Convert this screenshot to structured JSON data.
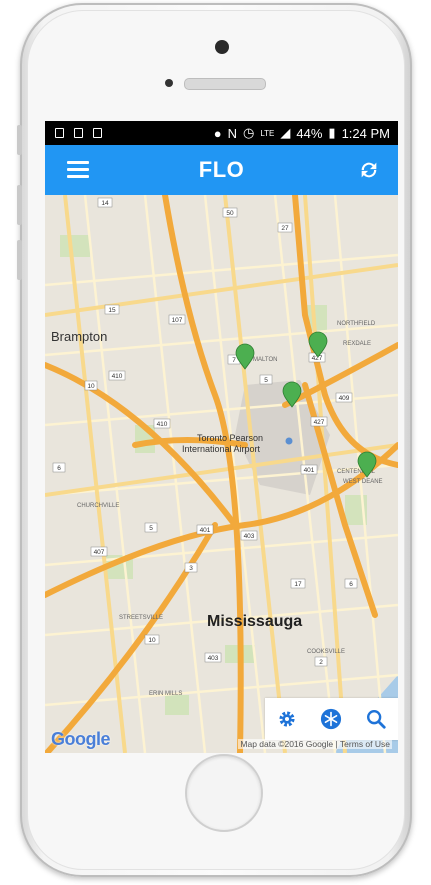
{
  "statusbar": {
    "battery": "44%",
    "time": "1:24 PM",
    "network": "LTE"
  },
  "appbar": {
    "title": "FLO",
    "menu_icon": "menu-icon",
    "refresh_icon": "refresh-icon"
  },
  "map": {
    "places": {
      "brampton": "Brampton",
      "mississauga": "Mississauga",
      "airport_line1": "Toronto Pearson",
      "airport_line2": "International Airport",
      "malton": "MALTON",
      "northfield": "NORTHFIELD",
      "rexdale": "REXDALE",
      "centennial": "CENTENNIAL",
      "west_deane": "WEST DEANE",
      "churchville": "CHURCHVILLE",
      "streetsville": "STREETSVILLE",
      "erin_mills": "ERIN MILLS",
      "cooksville": "COOKSVILLE"
    },
    "shields": [
      "14",
      "50",
      "27",
      "15",
      "107",
      "7",
      "410",
      "10",
      "427",
      "409",
      "5",
      "410",
      "427",
      "401",
      "6",
      "403",
      "401",
      "407",
      "5",
      "3",
      "17",
      "10",
      "403",
      "2",
      "6"
    ],
    "markers_count": 4,
    "logo": "Google",
    "attribution": "Map data ©2016 Google | Terms of Use"
  },
  "controls": {
    "settings_icon": "gear-icon",
    "filter_icon": "snowflake-icon",
    "search_icon": "search-icon"
  },
  "colors": {
    "appbar": "#2196f3",
    "marker": "#4caf50",
    "highway": "#f5b84a",
    "road": "#fbe4a8",
    "map_bg": "#e9e5dc"
  }
}
